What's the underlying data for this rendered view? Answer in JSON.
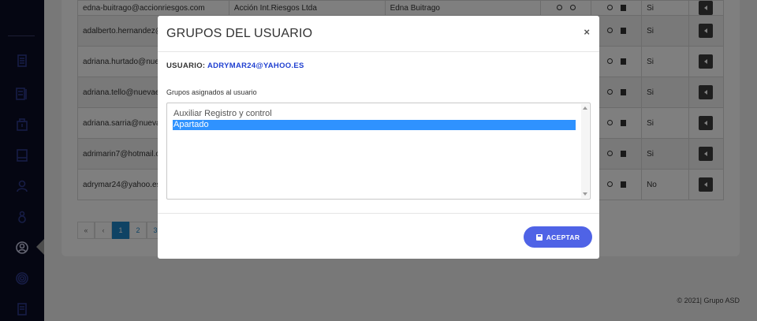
{
  "background": {
    "rows": [
      {
        "email": "edna-buitrago@accionriesgos.com",
        "company": "Acción Int.Riesgos Ltda",
        "name": "Edna Buitrago",
        "active": "Si"
      },
      {
        "email": "adalberto.hernandez@",
        "company": "",
        "name": "",
        "active": "Si"
      },
      {
        "email": "adriana.hurtado@nue",
        "company": "",
        "name": "",
        "active": "Si"
      },
      {
        "email": "adriana.tello@nuevae",
        "company": "",
        "name": "",
        "active": "Si"
      },
      {
        "email": "adriana.sarria@nueva",
        "company": "",
        "name": "",
        "active": "Si"
      },
      {
        "email": "adrimarin7@hotmail.c",
        "company": "",
        "name": "",
        "active": "Si"
      },
      {
        "email": "adrymar24@yahoo.es",
        "company": "",
        "name": "",
        "active": "No"
      }
    ],
    "pager": {
      "first": "«",
      "prev": "‹",
      "pages": [
        "1",
        "2",
        "3"
      ],
      "current": "1"
    },
    "footer": "© 2021| Grupo ASD"
  },
  "modal": {
    "title": "GRUPOS DEL USUARIO",
    "close": "×",
    "user_label": "USUARIO:",
    "user_value": "ADRYMAR24@YAHOO.ES",
    "groups_label": "Grupos asignados al usuario",
    "groups": [
      {
        "label": "Auxiliar Registro y control",
        "selected": false
      },
      {
        "label": "Apartado",
        "selected": true
      }
    ],
    "accept_label": "ACEPTAR"
  },
  "colors": {
    "sidebar": "#0b0d24",
    "accent": "#4f63e6",
    "selection": "#2f92ff",
    "link_blue": "#1f3fd0"
  },
  "icons": {
    "sidebar": [
      "document-icon",
      "list-icon",
      "briefcase-icon",
      "book-icon",
      "user-icon",
      "user-alt-icon",
      "user-circle-icon",
      "fingerprint-icon",
      "file-icon"
    ],
    "modal_button": "save-icon"
  }
}
